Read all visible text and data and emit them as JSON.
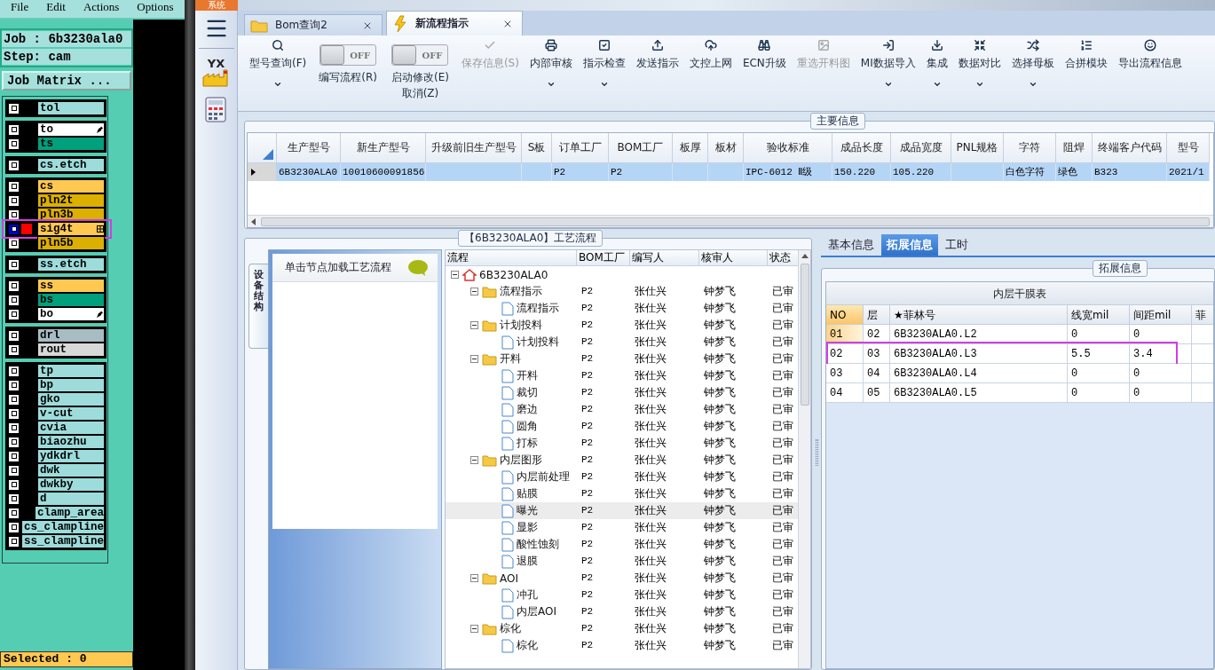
{
  "cam": {
    "menu": [
      "File",
      "Edit",
      "Actions",
      "Options"
    ],
    "job": "Job : 6b3230ala0",
    "step": "Step: cam",
    "matrix_button": "Job Matrix ...",
    "layer_groups": [
      [
        {
          "name": "tol",
          "color": "#9edcdc",
          "hand": false,
          "marked": false,
          "highlighted": false
        }
      ],
      [
        {
          "name": "to",
          "color": "#ffffff",
          "hand": true,
          "marked": false,
          "highlighted": false
        },
        {
          "name": "ts",
          "color": "#00a07c",
          "hand": false,
          "marked": false,
          "highlighted": false
        }
      ],
      [
        {
          "name": "cs.etch",
          "color": "#9edcdc",
          "hand": false,
          "marked": false,
          "highlighted": false
        }
      ],
      [
        {
          "name": "cs",
          "color": "#ffc850",
          "hand": false,
          "marked": false,
          "highlighted": false
        },
        {
          "name": "pln2t",
          "color": "#dcb000",
          "hand": false,
          "marked": false,
          "highlighted": false
        },
        {
          "name": "pln3b",
          "color": "#dcb000",
          "hand": false,
          "marked": false,
          "highlighted": false
        },
        {
          "name": "sig4t",
          "color": "#ffc850",
          "hand": false,
          "marked": true,
          "highlighted": true
        },
        {
          "name": "pln5b",
          "color": "#dcb000",
          "hand": false,
          "marked": false,
          "highlighted": false
        }
      ],
      [
        {
          "name": "ss.etch",
          "color": "#9edcdc",
          "hand": false,
          "marked": false,
          "highlighted": false
        }
      ],
      [
        {
          "name": "ss",
          "color": "#ffc850",
          "hand": false,
          "marked": false,
          "highlighted": false
        },
        {
          "name": "bs",
          "color": "#00a07c",
          "hand": false,
          "marked": false,
          "highlighted": false
        },
        {
          "name": "bo",
          "color": "#ffffff",
          "hand": true,
          "marked": false,
          "highlighted": false
        }
      ],
      [
        {
          "name": "drl",
          "color": "#a8bcc4",
          "hand": false,
          "marked": false,
          "highlighted": false
        },
        {
          "name": "rout",
          "color": "#d8d8d8",
          "hand": false,
          "marked": false,
          "highlighted": false
        }
      ],
      [
        {
          "name": "tp",
          "color": "#9edcdc",
          "hand": false,
          "marked": false,
          "highlighted": false
        },
        {
          "name": "bp",
          "color": "#9edcdc",
          "hand": false,
          "marked": false,
          "highlighted": false
        },
        {
          "name": "gko",
          "color": "#9edcdc",
          "hand": false,
          "marked": false,
          "highlighted": false
        },
        {
          "name": "v-cut",
          "color": "#9edcdc",
          "hand": false,
          "marked": false,
          "highlighted": false
        },
        {
          "name": "cvia",
          "color": "#9edcdc",
          "hand": false,
          "marked": false,
          "highlighted": false
        },
        {
          "name": "biaozhu",
          "color": "#9edcdc",
          "hand": false,
          "marked": false,
          "highlighted": false
        },
        {
          "name": "ydkdrl",
          "color": "#9edcdc",
          "hand": false,
          "marked": false,
          "highlighted": false
        },
        {
          "name": "dwk",
          "color": "#9edcdc",
          "hand": false,
          "marked": false,
          "highlighted": false
        },
        {
          "name": "dwkby",
          "color": "#9edcdc",
          "hand": false,
          "marked": false,
          "highlighted": false
        },
        {
          "name": "d",
          "color": "#9edcdc",
          "hand": false,
          "marked": false,
          "highlighted": false
        },
        {
          "name": "clamp_area",
          "color": "#9edcdc",
          "hand": false,
          "marked": false,
          "highlighted": false
        },
        {
          "name": "cs_clampline",
          "color": "#9edcdc",
          "hand": false,
          "marked": false,
          "highlighted": false
        },
        {
          "name": "ss_clampline",
          "color": "#9edcdc",
          "hand": false,
          "marked": false,
          "highlighted": false
        }
      ]
    ],
    "status": "Selected : 0"
  },
  "app": {
    "system_tab": "系统",
    "logo_text": "YX",
    "tabs": [
      {
        "label": "Bom查询2",
        "selected": false
      },
      {
        "label": "新流程指示",
        "selected": true
      }
    ],
    "toolbar": [
      {
        "kind": "button",
        "label": "型号查询(F)",
        "dropdown": true,
        "disabled": false
      },
      {
        "kind": "toggle",
        "switch_text": "OFF",
        "on": false,
        "label": "编写流程(R)"
      },
      {
        "kind": "toggle",
        "switch_text": "OFF",
        "on": false,
        "label": "启动修改(E)\n取消(Z)"
      },
      {
        "kind": "button",
        "label": "保存信息(S)",
        "dropdown": false,
        "disabled": true
      },
      {
        "kind": "button",
        "label": "内部审核",
        "dropdown": true,
        "disabled": false
      },
      {
        "kind": "button",
        "label": "指示检查",
        "dropdown": true,
        "disabled": false
      },
      {
        "kind": "button",
        "label": "发送指示",
        "dropdown": false,
        "disabled": false
      },
      {
        "kind": "button",
        "label": "文控上网",
        "dropdown": false,
        "disabled": false
      },
      {
        "kind": "button",
        "label": "ECN升级",
        "dropdown": false,
        "disabled": false
      },
      {
        "kind": "button",
        "label": "重选开料图",
        "dropdown": false,
        "disabled": true
      },
      {
        "kind": "button",
        "label": "MI数据导入",
        "dropdown": true,
        "disabled": false
      },
      {
        "kind": "button",
        "label": "集成",
        "dropdown": true,
        "disabled": false
      },
      {
        "kind": "button",
        "label": "数据对比",
        "dropdown": true,
        "disabled": false
      },
      {
        "kind": "button",
        "label": "选择母板",
        "dropdown": true,
        "disabled": false
      },
      {
        "kind": "button",
        "label": "合拼模块",
        "dropdown": false,
        "disabled": false
      },
      {
        "kind": "button",
        "label": "导出流程信息",
        "dropdown": false,
        "disabled": false
      }
    ],
    "main_info": {
      "title": "主要信息",
      "columns": [
        "生产型号",
        "新生产型号",
        "升级前旧生产型号",
        "S板",
        "订单工厂",
        "BOM工厂",
        "板厚",
        "板材",
        "验收标准",
        "成品长度",
        "成品宽度",
        "PNL规格",
        "字符",
        "阻焊",
        "终端客户代码",
        "型号"
      ],
      "rows": [
        {
          "selected": true,
          "cells": [
            "6B3230ALA0",
            "10010600091856",
            null,
            null,
            "P2",
            "P2",
            null,
            null,
            "IPC-6012 Ⅱ级",
            "150.220",
            "105.220",
            null,
            "白色字符",
            "绿色",
            "B323",
            "2021/1"
          ]
        }
      ]
    },
    "process": {
      "title": "【6B3230ALA0】工艺流程",
      "side_tab": "设备结构",
      "hint": "单击节点加载工艺流程",
      "columns": [
        "流程",
        "BOM工厂",
        "编写人",
        "核审人",
        "状态"
      ],
      "tree": {
        "name": "6B3230ALA0",
        "selected": false,
        "expanded": true,
        "children": [
          {
            "name": "流程指示",
            "cells": [
              "P2",
              "张仕兴",
              "钟梦飞",
              "已审"
            ],
            "selected": false,
            "expanded": true,
            "children": [
              {
                "name": "流程指示",
                "cells": [
                  "P2",
                  "张仕兴",
                  "钟梦飞",
                  "已审"
                ],
                "selected": false
              }
            ]
          },
          {
            "name": "计划投料",
            "cells": [
              "P2",
              "张仕兴",
              "钟梦飞",
              "已审"
            ],
            "selected": false,
            "expanded": true,
            "children": [
              {
                "name": "计划投料",
                "cells": [
                  "P2",
                  "张仕兴",
                  "钟梦飞",
                  "已审"
                ],
                "selected": false
              }
            ]
          },
          {
            "name": "开料",
            "cells": [
              "P2",
              "张仕兴",
              "钟梦飞",
              "已审"
            ],
            "selected": false,
            "expanded": true,
            "children": [
              {
                "name": "开料",
                "cells": [
                  "P2",
                  "张仕兴",
                  "钟梦飞",
                  "已审"
                ],
                "selected": false
              },
              {
                "name": "裁切",
                "cells": [
                  "P2",
                  "张仕兴",
                  "钟梦飞",
                  "已审"
                ],
                "selected": false
              },
              {
                "name": "磨边",
                "cells": [
                  "P2",
                  "张仕兴",
                  "钟梦飞",
                  "已审"
                ],
                "selected": false
              },
              {
                "name": "圆角",
                "cells": [
                  "P2",
                  "张仕兴",
                  "钟梦飞",
                  "已审"
                ],
                "selected": false
              },
              {
                "name": "打标",
                "cells": [
                  "P2",
                  "张仕兴",
                  "钟梦飞",
                  "已审"
                ],
                "selected": false
              }
            ]
          },
          {
            "name": "内层图形",
            "cells": [
              "P2",
              "张仕兴",
              "钟梦飞",
              "已审"
            ],
            "selected": false,
            "expanded": true,
            "children": [
              {
                "name": "内层前处理",
                "cells": [
                  "P2",
                  "张仕兴",
                  "钟梦飞",
                  "已审"
                ],
                "selected": false
              },
              {
                "name": "贴膜",
                "cells": [
                  "P2",
                  "张仕兴",
                  "钟梦飞",
                  "已审"
                ],
                "selected": false
              },
              {
                "name": "曝光",
                "cells": [
                  "P2",
                  "张仕兴",
                  "钟梦飞",
                  "已审"
                ],
                "selected": true
              },
              {
                "name": "显影",
                "cells": [
                  "P2",
                  "张仕兴",
                  "钟梦飞",
                  "已审"
                ],
                "selected": false
              },
              {
                "name": "酸性蚀刻",
                "cells": [
                  "P2",
                  "张仕兴",
                  "钟梦飞",
                  "已审"
                ],
                "selected": false
              },
              {
                "name": "退膜",
                "cells": [
                  "P2",
                  "张仕兴",
                  "钟梦飞",
                  "已审"
                ],
                "selected": false
              }
            ]
          },
          {
            "name": "AOI",
            "cells": [
              "P2",
              "张仕兴",
              "钟梦飞",
              "已审"
            ],
            "selected": false,
            "expanded": true,
            "children": [
              {
                "name": "冲孔",
                "cells": [
                  "P2",
                  "张仕兴",
                  "钟梦飞",
                  "已审"
                ],
                "selected": false
              },
              {
                "name": "内层AOI",
                "cells": [
                  "P2",
                  "张仕兴",
                  "钟梦飞",
                  "已审"
                ],
                "selected": false
              }
            ]
          },
          {
            "name": "棕化",
            "cells": [
              "P2",
              "张仕兴",
              "钟梦飞",
              "已审"
            ],
            "selected": false,
            "expanded": true,
            "children": [
              {
                "name": "棕化",
                "cells": [
                  "P2",
                  "张仕兴",
                  "钟梦飞",
                  "已审"
                ],
                "selected": false
              }
            ]
          }
        ]
      }
    },
    "detail": {
      "tabs": [
        {
          "label": "基本信息",
          "selected": false
        },
        {
          "label": "拓展信息",
          "selected": true
        },
        {
          "label": "工时",
          "selected": false
        }
      ],
      "group_title": "拓展信息",
      "table_title": "内层干膜表",
      "columns": [
        "NO",
        "层",
        "★菲林号",
        "线宽mil",
        "间距mil",
        "菲"
      ],
      "rows": [
        {
          "cells": [
            "01",
            "02",
            "6B3230ALA0.L2",
            "0",
            "0"
          ],
          "current": true,
          "highlighted": false
        },
        {
          "cells": [
            "02",
            "03",
            "6B3230ALA0.L3",
            "5.5",
            "3.4"
          ],
          "current": false,
          "highlighted": true
        },
        {
          "cells": [
            "03",
            "04",
            "6B3230ALA0.L4",
            "0",
            "0"
          ],
          "current": false,
          "highlighted": false
        },
        {
          "cells": [
            "04",
            "05",
            "6B3230ALA0.L5",
            "0",
            "0"
          ],
          "current": false,
          "highlighted": false
        }
      ]
    }
  }
}
